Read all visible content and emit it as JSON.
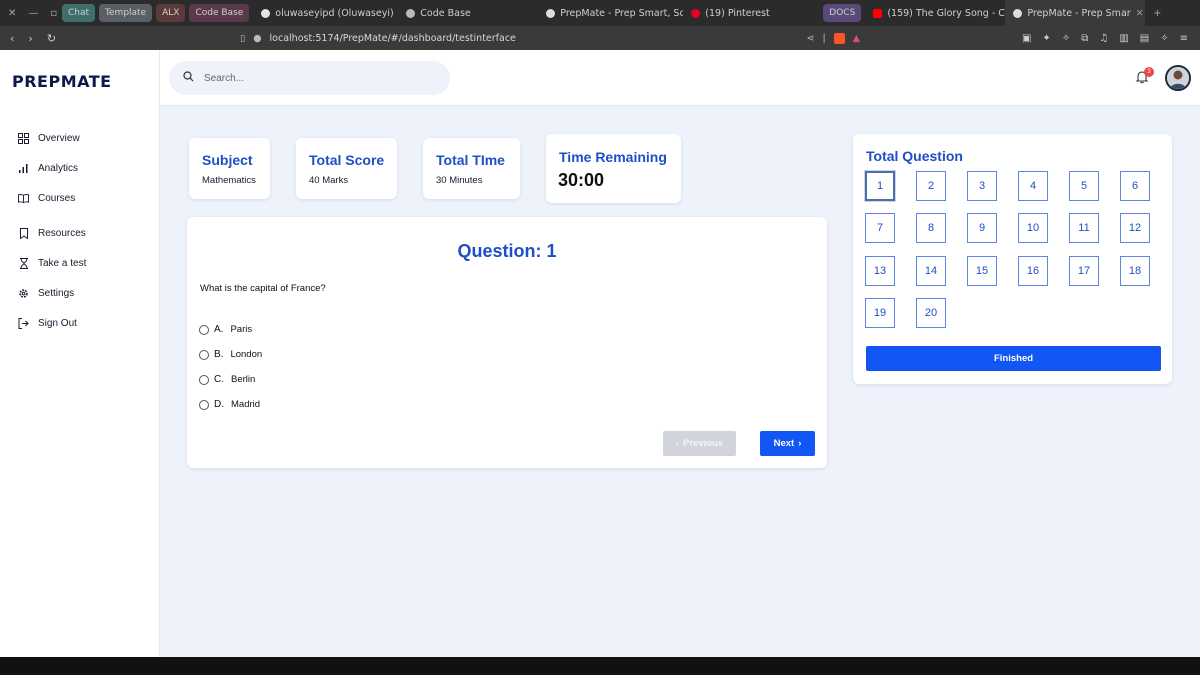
{
  "browser": {
    "pills": [
      {
        "label": "Chat",
        "bg": "#3f6f6a"
      },
      {
        "label": "Template",
        "bg": "#5a5f66"
      },
      {
        "label": "ALX",
        "bg": "#5a3a3a"
      },
      {
        "label": "Code Base",
        "bg": "#5a3a4a"
      }
    ],
    "tabs": [
      {
        "label": "oluwaseyipd (Oluwaseyi)",
        "icon": "github-icon"
      },
      {
        "label": "Code Base",
        "icon": "globe-icon"
      },
      {
        "label": "PrepMate - Prep Smart, Sc",
        "icon": "prepmate-icon"
      },
      {
        "label": "(19) Pinterest",
        "icon": "pinterest-icon"
      },
      {
        "label": "DOCS",
        "icon": "docs-pill"
      },
      {
        "label": "(159) The Glory Song - C",
        "icon": "youtube-icon"
      },
      {
        "label": "PrepMate - Prep Smar",
        "icon": "prepmate-icon"
      }
    ],
    "url": "localhost:5174/PrepMate/#/dashboard/testinterface"
  },
  "brand": {
    "logo": "PREPMATE",
    "primary": "#1f4fc4",
    "button": "#1256f5"
  },
  "sidebar": {
    "items": [
      {
        "label": "Overview",
        "icon": "grid-icon"
      },
      {
        "label": "Analytics",
        "icon": "bar-chart-icon"
      },
      {
        "label": "Courses",
        "icon": "book-icon"
      },
      {
        "label": "Resources",
        "icon": "bookmark-icon"
      },
      {
        "label": "Take a test",
        "icon": "hourglass-icon"
      },
      {
        "label": "Settings",
        "icon": "gear-icon"
      },
      {
        "label": "Sign Out",
        "icon": "sign-out-icon"
      }
    ]
  },
  "header": {
    "search_placeholder": "Search...",
    "notification_count": "3"
  },
  "test_info": {
    "subject_label": "Subject",
    "subject_value": "Mathematics",
    "score_label": "Total Score",
    "score_value": "40 Marks",
    "time_label": "Total TIme",
    "time_value": "30 Minutes",
    "remaining_label": "Time Remaining",
    "remaining_value": "30:00"
  },
  "question": {
    "title": "Question: 1",
    "text": "What is the capital of France?",
    "options": [
      {
        "letter": "A.",
        "text": "Paris"
      },
      {
        "letter": "B.",
        "text": "London"
      },
      {
        "letter": "C.",
        "text": "Berlin"
      },
      {
        "letter": "D.",
        "text": "Madrid"
      }
    ],
    "prev_label": "Previous",
    "next_label": "Next"
  },
  "questions_panel": {
    "title": "Total Question",
    "numbers": [
      "1",
      "2",
      "3",
      "4",
      "5",
      "6",
      "7",
      "8",
      "9",
      "10",
      "11",
      "12",
      "13",
      "14",
      "15",
      "16",
      "17",
      "18",
      "19",
      "20"
    ],
    "active": "1",
    "finish_label": "Finished"
  }
}
